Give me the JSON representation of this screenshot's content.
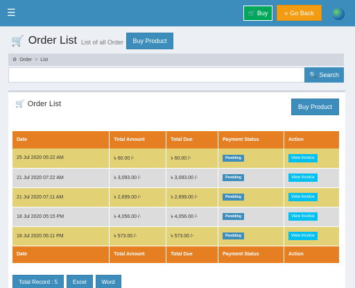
{
  "topbar": {
    "buy_label": "Buy",
    "goback_label": "Go Back"
  },
  "header": {
    "title": "Order List",
    "subtitle": "List of all Order",
    "buy_product_label": "Buy Product"
  },
  "breadcrumb": {
    "items": [
      "Order",
      "List"
    ]
  },
  "search": {
    "placeholder": "",
    "value": "",
    "button_label": "Search"
  },
  "box": {
    "title": "Order List",
    "buy_product_label": "Buy Product"
  },
  "table": {
    "columns": [
      "Date",
      "Total Amount",
      "Total Due",
      "Payment Status",
      "Action"
    ],
    "rows": [
      {
        "date": "25 Jul 2020 05:22 AM",
        "total_amount": "৳ 60.00 /-",
        "total_due": "৳ 60.00 /-",
        "status": "Pendding",
        "action": "View Invoice"
      },
      {
        "date": "21 Jul 2020 07:22 AM",
        "total_amount": "৳ 3,093.00 /-",
        "total_due": "৳ 3,093.00 /-",
        "status": "Pendding",
        "action": "View Invoice"
      },
      {
        "date": "21 Jul 2020 07:11 AM",
        "total_amount": "৳ 2,699.00 /-",
        "total_due": "৳ 2,699.00 /-",
        "status": "Pendding",
        "action": "View Invoice"
      },
      {
        "date": "18 Jul 2020 05:15 PM",
        "total_amount": "৳ 4,056.00 /-",
        "total_due": "৳ 4,056.00 /-",
        "status": "Pendding",
        "action": "View Invoice"
      },
      {
        "date": "18 Jul 2020 05:11 PM",
        "total_amount": "৳ 573.00 /-",
        "total_due": "৳ 573.00 /-",
        "status": "Pendding",
        "action": "View Invoice"
      }
    ]
  },
  "footer": {
    "total_record": "Total Record : 5",
    "excel": "Excel",
    "word": "Word"
  },
  "colors": {
    "topbar": "#3c8dbc",
    "table_header": "#e67e22",
    "row_odd": "#e3d275",
    "row_even": "#dcdcdc"
  }
}
